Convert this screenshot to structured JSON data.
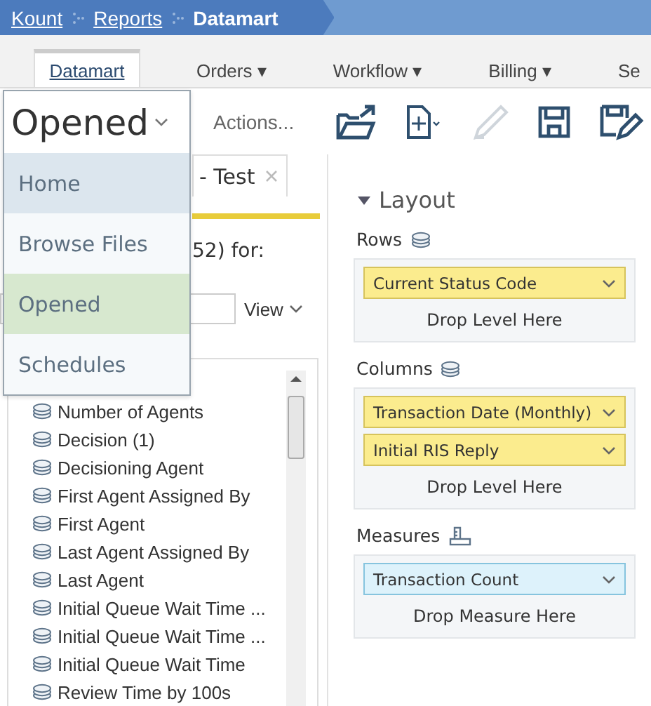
{
  "breadcrumb": [
    {
      "label": "Kount",
      "kind": "link"
    },
    {
      "label": "Reports",
      "kind": "link"
    },
    {
      "label": "Datamart",
      "kind": "current"
    }
  ],
  "nav_tabs": [
    {
      "label": "Datamart",
      "selected": true
    },
    {
      "label": "Orders ▾",
      "selected": false
    },
    {
      "label": "Workflow ▾",
      "selected": false
    },
    {
      "label": "Billing ▾",
      "selected": false
    },
    {
      "label": "Se",
      "selected": false
    }
  ],
  "view_dropdown": {
    "value": "Opened",
    "expanded": true,
    "options": [
      {
        "label": "Home",
        "selected": false,
        "hovered": true
      },
      {
        "label": "Browse Files",
        "selected": false,
        "hovered": false
      },
      {
        "label": "Opened",
        "selected": true,
        "hovered": false
      },
      {
        "label": "Schedules",
        "selected": false,
        "hovered": false
      }
    ]
  },
  "toolbar": {
    "actions_label": "Actions...",
    "buttons": [
      {
        "kind": "open",
        "disabled": false
      },
      {
        "kind": "new",
        "disabled": false
      },
      {
        "kind": "edit",
        "disabled": true
      },
      {
        "kind": "save",
        "disabled": false
      },
      {
        "kind": "save-as",
        "disabled": false
      }
    ]
  },
  "document_tab": {
    "label": "- Test",
    "closable": true
  },
  "left_panel": {
    "count_text": "52) for:",
    "view_button": "View",
    "items": [
      {
        "label": "Number of Agents"
      },
      {
        "label": "Decision (1)"
      },
      {
        "label": "Decisioning Agent"
      },
      {
        "label": "First Agent Assigned By"
      },
      {
        "label": "First Agent"
      },
      {
        "label": "Last Agent Assigned By"
      },
      {
        "label": "Last Agent"
      },
      {
        "label": "Initial Queue Wait Time ..."
      },
      {
        "label": "Initial Queue Wait Time ..."
      },
      {
        "label": "Initial Queue Wait Time"
      },
      {
        "label": "Review Time by 100s"
      }
    ]
  },
  "layout": {
    "title": "Layout",
    "expanded": true,
    "sections": [
      {
        "label": "Rows",
        "kind": "levels",
        "items": [
          "Current Status Code"
        ],
        "drop_hint": "Drop Level Here"
      },
      {
        "label": "Columns",
        "kind": "levels",
        "items": [
          "Transaction Date (Monthly)",
          "Initial RIS Reply"
        ],
        "drop_hint": "Drop Level Here"
      },
      {
        "label": "Measures",
        "kind": "measures",
        "items": [
          "Transaction Count"
        ],
        "drop_hint": "Drop Measure Here"
      }
    ]
  }
}
